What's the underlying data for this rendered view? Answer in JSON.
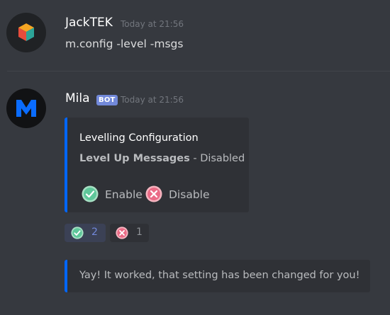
{
  "messages": [
    {
      "username": "JackTEK",
      "timestamp": "Today at 21:56",
      "text": "m.config -level -msgs",
      "avatar_icon": "cube-icon"
    },
    {
      "username": "Mila",
      "bot_tag": "BOT",
      "timestamp": "Today at 21:56",
      "avatar_icon": "m-logo-icon",
      "embed": {
        "accent_color": "#0066ff",
        "title": "Levelling Configuration",
        "field_name": "Level Up Messages",
        "field_separator": " - ",
        "field_value": "Disabled",
        "options": [
          {
            "icon": "check-circle-icon",
            "label": "Enable"
          },
          {
            "icon": "x-circle-icon",
            "label": "Disable"
          }
        ]
      },
      "reactions": [
        {
          "icon": "check-circle-icon",
          "count": "2",
          "reacted": true
        },
        {
          "icon": "x-circle-icon",
          "count": "1",
          "reacted": false
        }
      ],
      "confirmation_embed": {
        "accent_color": "#0066ff",
        "text": "Yay! It worked, that setting has been changed for you!"
      }
    }
  ],
  "colors": {
    "background": "#36393f",
    "embed_bg": "#2f3136",
    "bot_tag": "#7289da",
    "check_green": "#43b581",
    "x_red": "#f04747"
  }
}
